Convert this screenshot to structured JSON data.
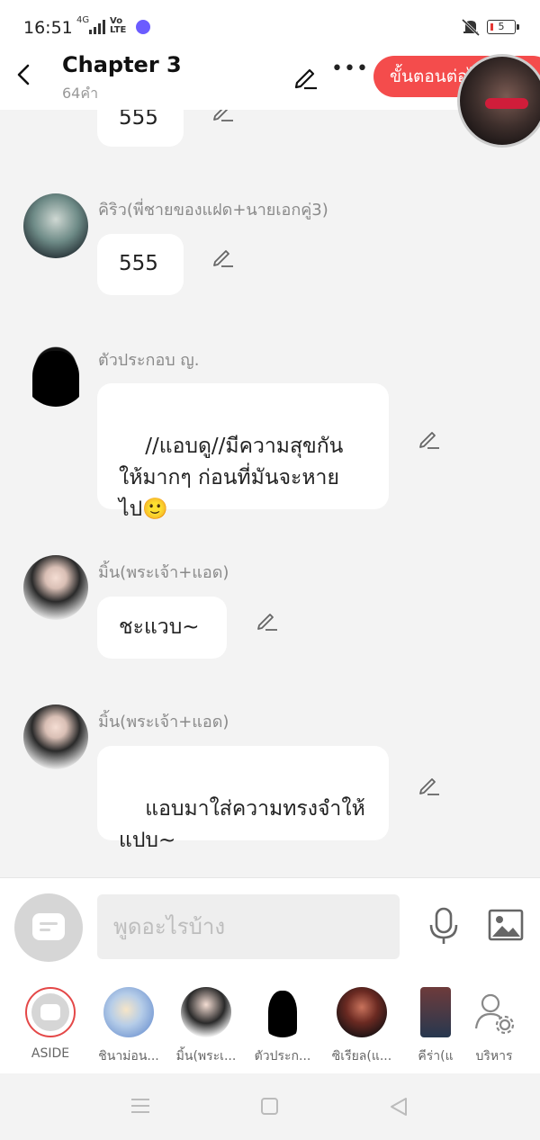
{
  "status_bar": {
    "time": "16:51",
    "network": "4G",
    "volte": "Vo\nLTE",
    "battery": "5"
  },
  "header": {
    "title": "Chapter 3",
    "word_count": "64คำ",
    "steps_button": "ขั้นตอนต่อไป"
  },
  "messages": [
    {
      "sender": "",
      "text": "555"
    },
    {
      "sender": "คิริว(พี่ชายของแฝด+นายเอกคู่3)",
      "text": "555"
    },
    {
      "sender": "ตัวประกอบ ญ.",
      "text": "//แอบดู//มีความสุขกัน\nให้มากๆ ก่อนที่มันจะหาย\nไป🙂"
    },
    {
      "sender": "มิ้น(พระเจ้า+แอด)",
      "text": "ชะแวบ~"
    },
    {
      "sender": "มิ้น(พระเจ้า+แอด)",
      "text": "แอบมาใส่ความทรงจำให้\nแปบ~"
    }
  ],
  "input": {
    "placeholder": "พูดอะไรบ้าง"
  },
  "characters": [
    {
      "label": "ASIDE"
    },
    {
      "label": "ชินาม่อน..."
    },
    {
      "label": "มิ้น(พระเ..."
    },
    {
      "label": "ตัวประก..."
    },
    {
      "label": "ซิเรียล(แ..."
    },
    {
      "label": "คีร่า(แ"
    },
    {
      "label": "บริหาร"
    }
  ],
  "colors": {
    "accent": "#f44c4c",
    "background": "#f3f3f3",
    "bubble": "#ffffff"
  }
}
